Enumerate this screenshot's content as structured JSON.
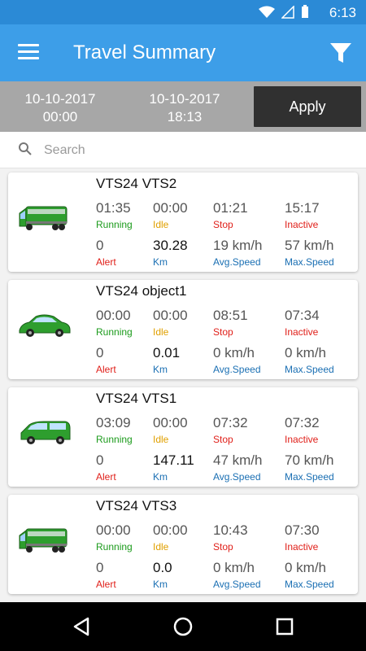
{
  "status": {
    "time": "6:13"
  },
  "header": {
    "title": "Travel Summary"
  },
  "dates": {
    "from_date": "10-10-2017",
    "from_time": "00:00",
    "to_date": "10-10-2017",
    "to_time": "18:13",
    "apply_label": "Apply"
  },
  "search": {
    "placeholder": "Search"
  },
  "vehicles": [
    {
      "name": "VTS24   VTS2",
      "type": "bus",
      "color": "#2e9e2e",
      "running": "01:35",
      "idle": "00:00",
      "stop": "01:21",
      "inactive": "15:17",
      "alert": "0",
      "km": "30.28",
      "avg_speed": "19 km/h",
      "max_speed": "57 km/h"
    },
    {
      "name": "VTS24   object1",
      "type": "car",
      "color": "#2e9e2e",
      "running": "00:00",
      "idle": "00:00",
      "stop": "08:51",
      "inactive": "07:34",
      "alert": "0",
      "km": "0.01",
      "avg_speed": "0 km/h",
      "max_speed": "0 km/h"
    },
    {
      "name": "VTS24   VTS1",
      "type": "van",
      "color": "#2e9e2e",
      "running": "03:09",
      "idle": "00:00",
      "stop": "07:32",
      "inactive": "07:32",
      "alert": "0",
      "km": "147.11",
      "avg_speed": "47 km/h",
      "max_speed": "70 km/h"
    },
    {
      "name": "VTS24   VTS3",
      "type": "bus",
      "color": "#2e9e2e",
      "running": "00:00",
      "idle": "00:00",
      "stop": "10:43",
      "inactive": "07:30",
      "alert": "0",
      "km": "0.0",
      "avg_speed": "0 km/h",
      "max_speed": "0 km/h"
    }
  ],
  "labels": {
    "running": "Running",
    "idle": "Idle",
    "stop": "Stop",
    "inactive": "Inactive",
    "alert": "Alert",
    "km": "Km",
    "avg_speed": "Avg.Speed",
    "max_speed": "Max.Speed"
  },
  "colors": {
    "status_bar": "#2b8ad6",
    "app_bar": "#3d9ee8",
    "date_bar": "#a7a7a7",
    "running": "#1c9b1c",
    "idle": "#e0a000",
    "stop": "#e0201a",
    "info": "#1a6fb3"
  },
  "icons": {
    "menu": "hamburger-icon",
    "filter": "filter-funnel-icon",
    "search": "search-icon",
    "nav_back": "triangle-back-icon",
    "nav_home": "circle-home-icon",
    "nav_recent": "square-recents-icon"
  }
}
